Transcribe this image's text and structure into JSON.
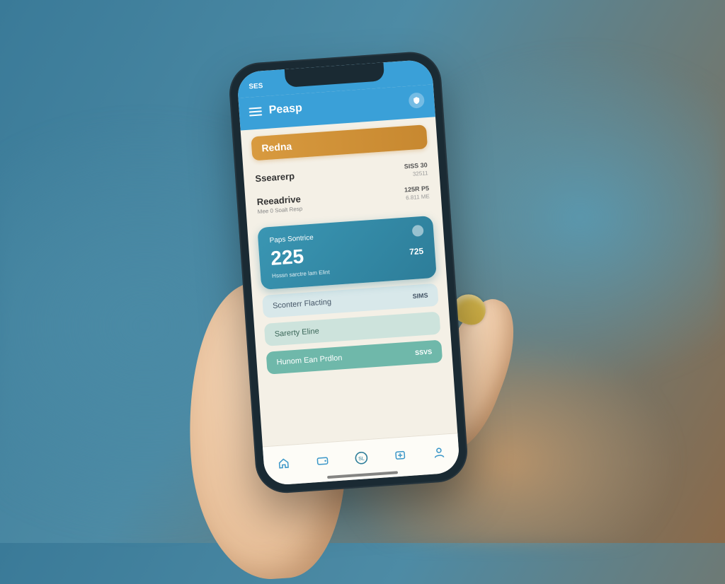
{
  "status": {
    "left": "SES",
    "right": ""
  },
  "header": {
    "title": "Peasp"
  },
  "banner": {
    "label": "Redna"
  },
  "rows": [
    {
      "title": "Ssearerp",
      "sub": "",
      "val1": "SISS 30",
      "val2": "32511"
    },
    {
      "title": "Reeadrive",
      "sub": "Mee 0 Soalt Resp",
      "val1": "125R P5",
      "val2": "6.811 ME"
    }
  ],
  "balance": {
    "label": "Paps Sontrice",
    "amount": "225",
    "foot": "Hsssn sarctre lam Elint",
    "right": "725"
  },
  "pills": [
    {
      "label": "Sconterr Flacting",
      "tag": "SIMS"
    },
    "Sarerty Eline",
    {
      "label": "Hunom Ean Prdlon",
      "tag": "SSVS"
    }
  ],
  "tabs": [
    "home",
    "wallet",
    "card",
    "plus",
    "profile"
  ]
}
